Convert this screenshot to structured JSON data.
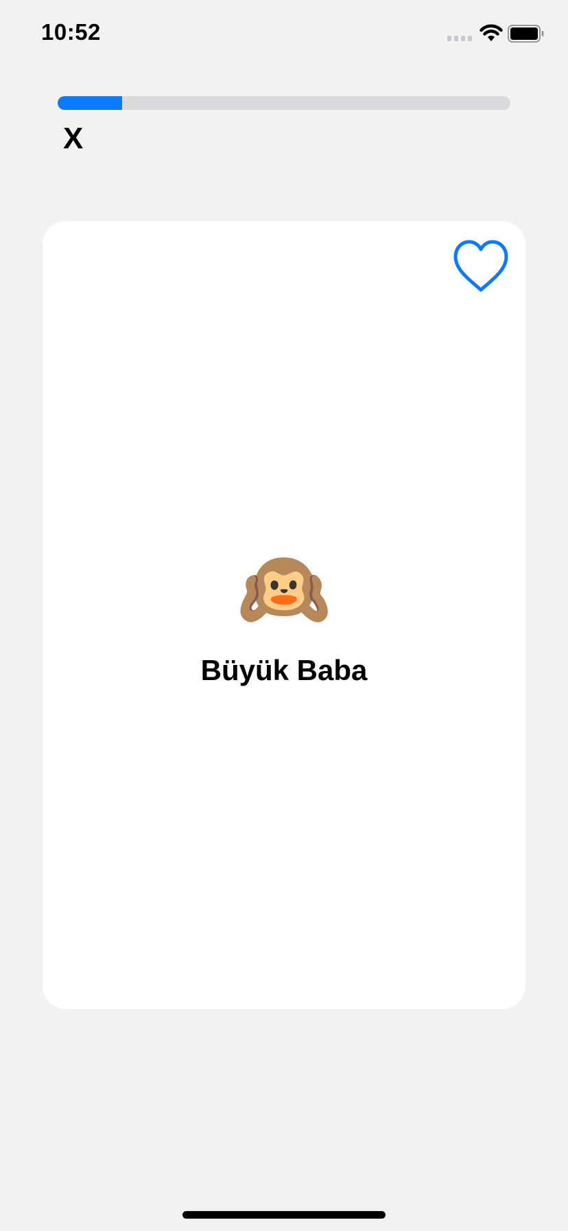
{
  "status_bar": {
    "time": "10:52"
  },
  "progress": {
    "fraction": 0.143,
    "color": "#0a7aff"
  },
  "close_label": "X",
  "card": {
    "emoji": "🙉",
    "emoji_name": "hear-no-evil-monkey",
    "word": "Büyük Baba",
    "favorite_icon": "heart-outline-icon",
    "favorite_color": "#0a7aff"
  },
  "colors": {
    "background": "#f2f2f2",
    "card": "#ffffff",
    "track": "#dadadd"
  }
}
